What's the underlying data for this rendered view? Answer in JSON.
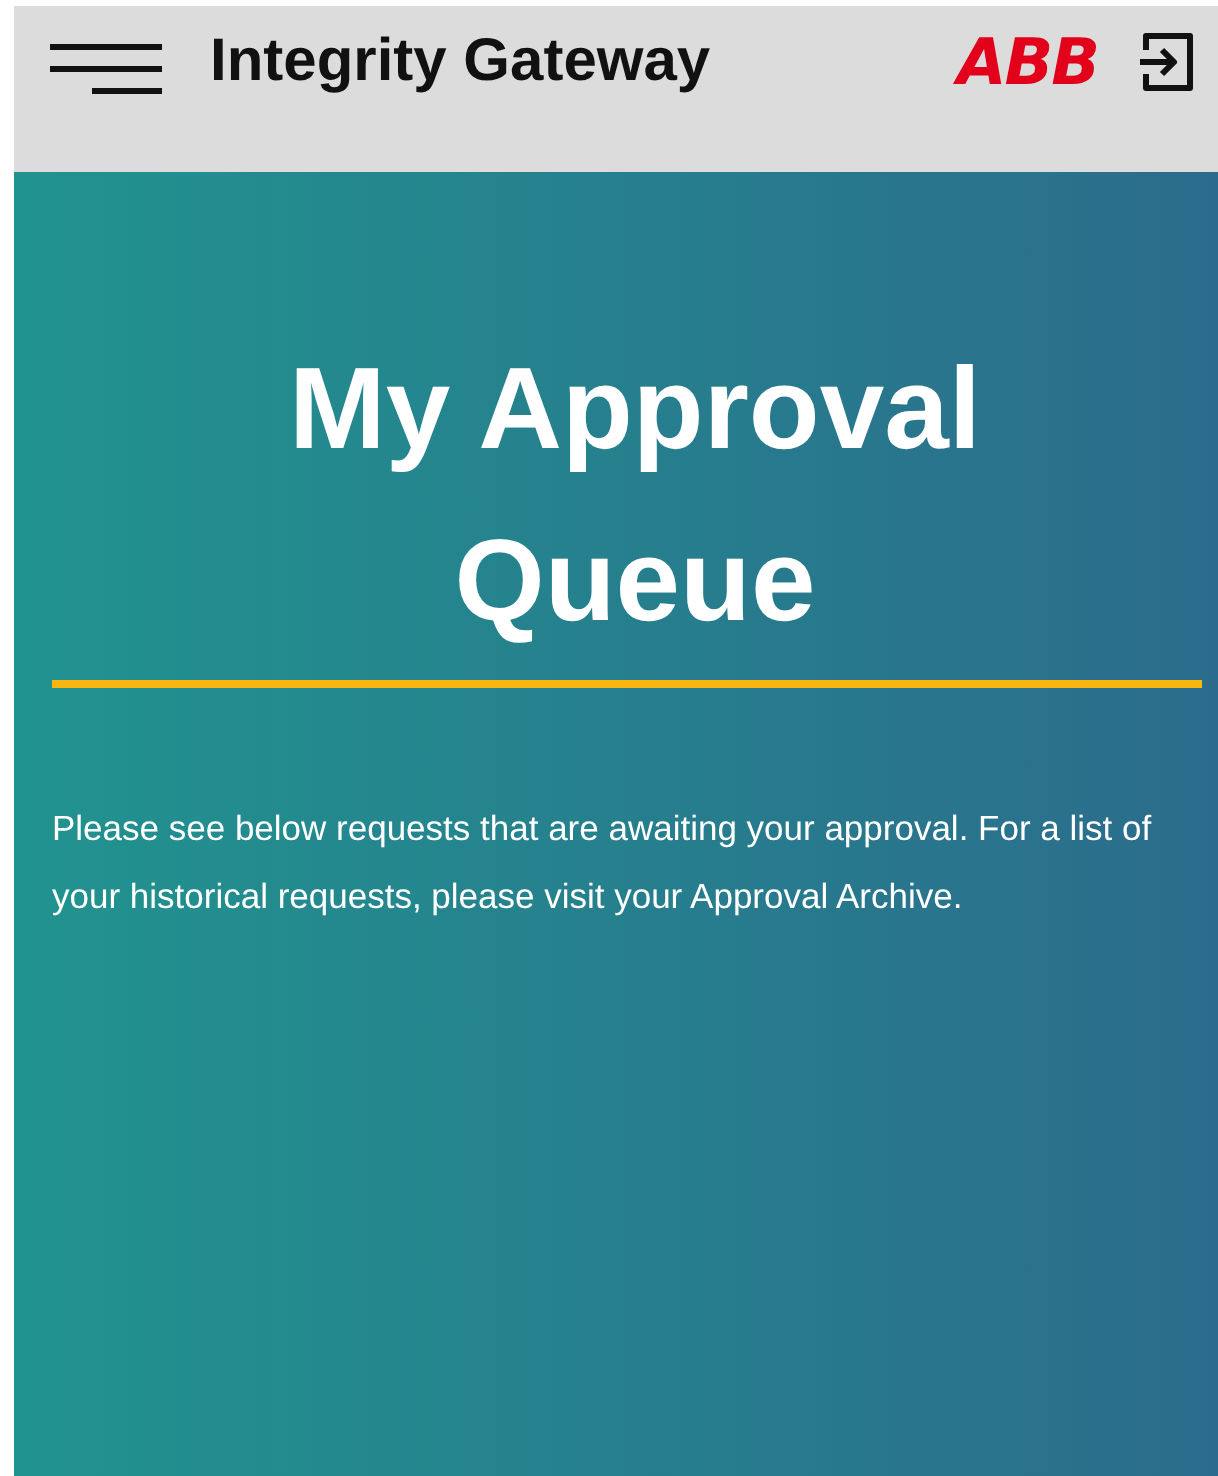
{
  "header": {
    "app_title": "Integrity Gateway",
    "logo": "ABB"
  },
  "page": {
    "title": "My Approval Queue",
    "intro": "Please see below requests that are awaiting your approval. For a list of your historical requests, please visit your Approval Archive."
  }
}
